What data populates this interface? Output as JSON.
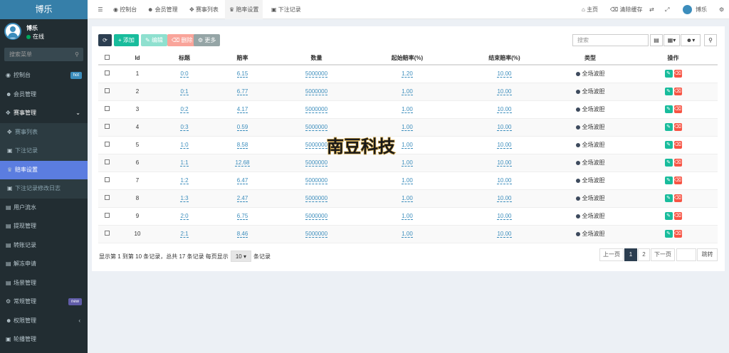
{
  "app": {
    "brand": "博乐"
  },
  "user": {
    "name": "博乐",
    "status": "在线"
  },
  "sidebar": {
    "search_placeholder": "搜索菜单",
    "items": [
      {
        "label": "控制台",
        "icon": "dashboard-icon",
        "badge": "hot",
        "badge_color": "#3c8dbc"
      },
      {
        "label": "会员管理",
        "icon": "users-icon"
      },
      {
        "label": "赛事管理",
        "icon": "gamepad-icon"
      },
      {
        "label": "赛事列表",
        "icon": "game-icon"
      },
      {
        "label": "下注记录",
        "icon": "calendar-icon"
      },
      {
        "label": "赔率设置",
        "icon": "crown-icon"
      },
      {
        "label": "下注记录修改日志",
        "icon": "calendar-icon"
      },
      {
        "label": "用户流水",
        "icon": "list-icon"
      },
      {
        "label": "提现管理",
        "icon": "list-icon"
      },
      {
        "label": "转账记录",
        "icon": "list-icon"
      },
      {
        "label": "解冻申请",
        "icon": "list-icon"
      },
      {
        "label": "场景管理",
        "icon": "list-icon"
      },
      {
        "label": "常规管理",
        "icon": "cogs-icon",
        "badge": "new",
        "badge_color": "#605ca8"
      },
      {
        "label": "权限管理",
        "icon": "group-icon"
      },
      {
        "label": "轮播管理",
        "icon": "image-icon"
      }
    ]
  },
  "topbar": {
    "tabs": [
      "控制台",
      "会员管理",
      "赛事列表",
      "赔率设置",
      "下注记录"
    ],
    "home": "主页",
    "clear_cache": "清除缓存",
    "username": "博乐"
  },
  "toolbar": {
    "add": "添加",
    "edit": "编辑",
    "delete": "删除",
    "more": "更多",
    "search_placeholder": "搜索"
  },
  "table": {
    "headers": [
      "Id",
      "标题",
      "赔率",
      "数量",
      "起始赔率(%)",
      "结束赔率(%)",
      "类型",
      "操作"
    ],
    "rows": [
      {
        "id": "1",
        "title": "0:0",
        "odds": "6.15",
        "qty": "5000000",
        "start": "1.20",
        "end": "10.00",
        "type": "全场波胆"
      },
      {
        "id": "2",
        "title": "0:1",
        "odds": "6.77",
        "qty": "5000000",
        "start": "1.00",
        "end": "10.00",
        "type": "全场波胆"
      },
      {
        "id": "3",
        "title": "0:2",
        "odds": "4.17",
        "qty": "5000000",
        "start": "1.00",
        "end": "10.00",
        "type": "全场波胆"
      },
      {
        "id": "4",
        "title": "0:3",
        "odds": "0.59",
        "qty": "5000000",
        "start": "1.00",
        "end": "10.00",
        "type": "全场波胆"
      },
      {
        "id": "5",
        "title": "1:0",
        "odds": "8.58",
        "qty": "5000000",
        "start": "1.00",
        "end": "10.00",
        "type": "全场波胆"
      },
      {
        "id": "6",
        "title": "1:1",
        "odds": "12.68",
        "qty": "5000000",
        "start": "1.00",
        "end": "10.00",
        "type": "全场波胆"
      },
      {
        "id": "7",
        "title": "1:2",
        "odds": "6.47",
        "qty": "5000000",
        "start": "1.00",
        "end": "10.00",
        "type": "全场波胆"
      },
      {
        "id": "8",
        "title": "1:3",
        "odds": "2.47",
        "qty": "5000000",
        "start": "1.00",
        "end": "10.00",
        "type": "全场波胆"
      },
      {
        "id": "9",
        "title": "2:0",
        "odds": "6.75",
        "qty": "5000000",
        "start": "1.00",
        "end": "10.00",
        "type": "全场波胆"
      },
      {
        "id": "10",
        "title": "2:1",
        "odds": "8.46",
        "qty": "5000000",
        "start": "1.00",
        "end": "10.00",
        "type": "全场波胆"
      }
    ]
  },
  "pagination": {
    "info_prefix": "显示第 1 到第 10 条记录，总共 17 条记录 每页显示",
    "page_size": "10",
    "info_suffix": "条记录",
    "prev": "上一页",
    "page1": "1",
    "page2": "2",
    "next": "下一页",
    "jump": "跳转"
  },
  "watermark_text": "南豆科技"
}
